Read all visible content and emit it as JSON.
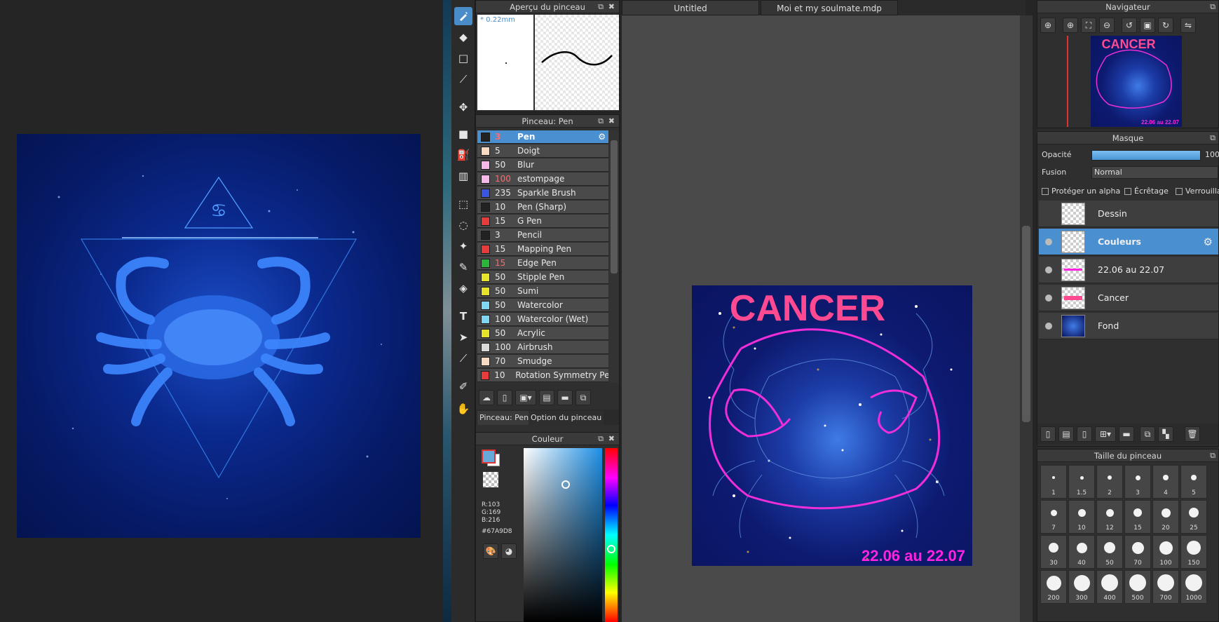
{
  "brush_preview": {
    "title": "Aperçu du pinceau",
    "size_label": "* 0.22mm"
  },
  "brush_panel": {
    "title": "Pinceau: Pen",
    "items": [
      {
        "size": "3",
        "name": "Pen",
        "color": "#222222",
        "size_red": true
      },
      {
        "size": "5",
        "name": "Doigt",
        "color": "#f8d9c2",
        "size_red": false
      },
      {
        "size": "50",
        "name": "Blur",
        "color": "#f5b8e8",
        "size_red": false
      },
      {
        "size": "100",
        "name": "estompage",
        "color": "#f5b8e8",
        "size_red": true
      },
      {
        "size": "235",
        "name": "Sparkle Brush",
        "color": "#3a55e0",
        "size_red": false
      },
      {
        "size": "10",
        "name": "Pen (Sharp)",
        "color": "#222222",
        "size_red": false
      },
      {
        "size": "15",
        "name": "G Pen",
        "color": "#e83b3b",
        "size_red": false
      },
      {
        "size": "3",
        "name": "Pencil",
        "color": "#222222",
        "size_red": false
      },
      {
        "size": "15",
        "name": "Mapping Pen",
        "color": "#e83b3b",
        "size_red": false
      },
      {
        "size": "15",
        "name": "Edge Pen",
        "color": "#2bb53a",
        "size_red": true
      },
      {
        "size": "50",
        "name": "Stipple Pen",
        "color": "#e7e22a",
        "size_red": false
      },
      {
        "size": "50",
        "name": "Sumi",
        "color": "#e7e22a",
        "size_red": false
      },
      {
        "size": "50",
        "name": "Watercolor",
        "color": "#7fd6f2",
        "size_red": false
      },
      {
        "size": "100",
        "name": "Watercolor (Wet)",
        "color": "#7fd6f2",
        "size_red": false
      },
      {
        "size": "50",
        "name": "Acrylic",
        "color": "#e7e22a",
        "size_red": false
      },
      {
        "size": "100",
        "name": "Airbrush",
        "color": "#d9d9d9",
        "size_red": false
      },
      {
        "size": "70",
        "name": "Smudge",
        "color": "#f8d9c2",
        "size_red": false
      },
      {
        "size": "10",
        "name": "Rotation Symmetry Pen",
        "color": "#e83b3b",
        "size_red": false
      }
    ],
    "tab_brush": "Pinceau: Pen",
    "tab_option": "Option du pinceau"
  },
  "color_panel": {
    "title": "Couleur",
    "r": "R:103",
    "g": "G:169",
    "b": "B:216",
    "hex": "#67A9D8",
    "current_color": "#67A9D8"
  },
  "tabs": [
    "Untitled",
    "Moi et my soulmate.mdp"
  ],
  "artwork": {
    "title_text": "CANCER",
    "date_text": "22.06 au 22.07"
  },
  "navigator": {
    "title": "Navigateur",
    "thumb_title": "CANCER",
    "thumb_date": "22.06 au 22.07"
  },
  "layers_panel": {
    "title": "Masque",
    "opacity_label": "Opacité",
    "opacity_value": "100",
    "opacity_level": 1.0,
    "blend_label": "Fusion",
    "blend_value": "Normal",
    "protect_alpha": "Protéger un alpha",
    "clipping": "Écrêtage",
    "lock": "Verrouillag",
    "layers": [
      {
        "name": "Dessin",
        "selected": false
      },
      {
        "name": "Couleurs",
        "selected": true
      },
      {
        "name": "22.06 au 22.07",
        "selected": false
      },
      {
        "name": "Cancer",
        "selected": false
      },
      {
        "name": "Fond",
        "selected": false
      }
    ]
  },
  "brush_size_panel": {
    "title": "Taille du pinceau",
    "sizes": [
      "1",
      "1.5",
      "2",
      "3",
      "4",
      "5",
      "7",
      "10",
      "12",
      "15",
      "20",
      "25",
      "30",
      "40",
      "50",
      "70",
      "100",
      "150",
      "200",
      "300",
      "400",
      "500",
      "700",
      "1000"
    ]
  }
}
